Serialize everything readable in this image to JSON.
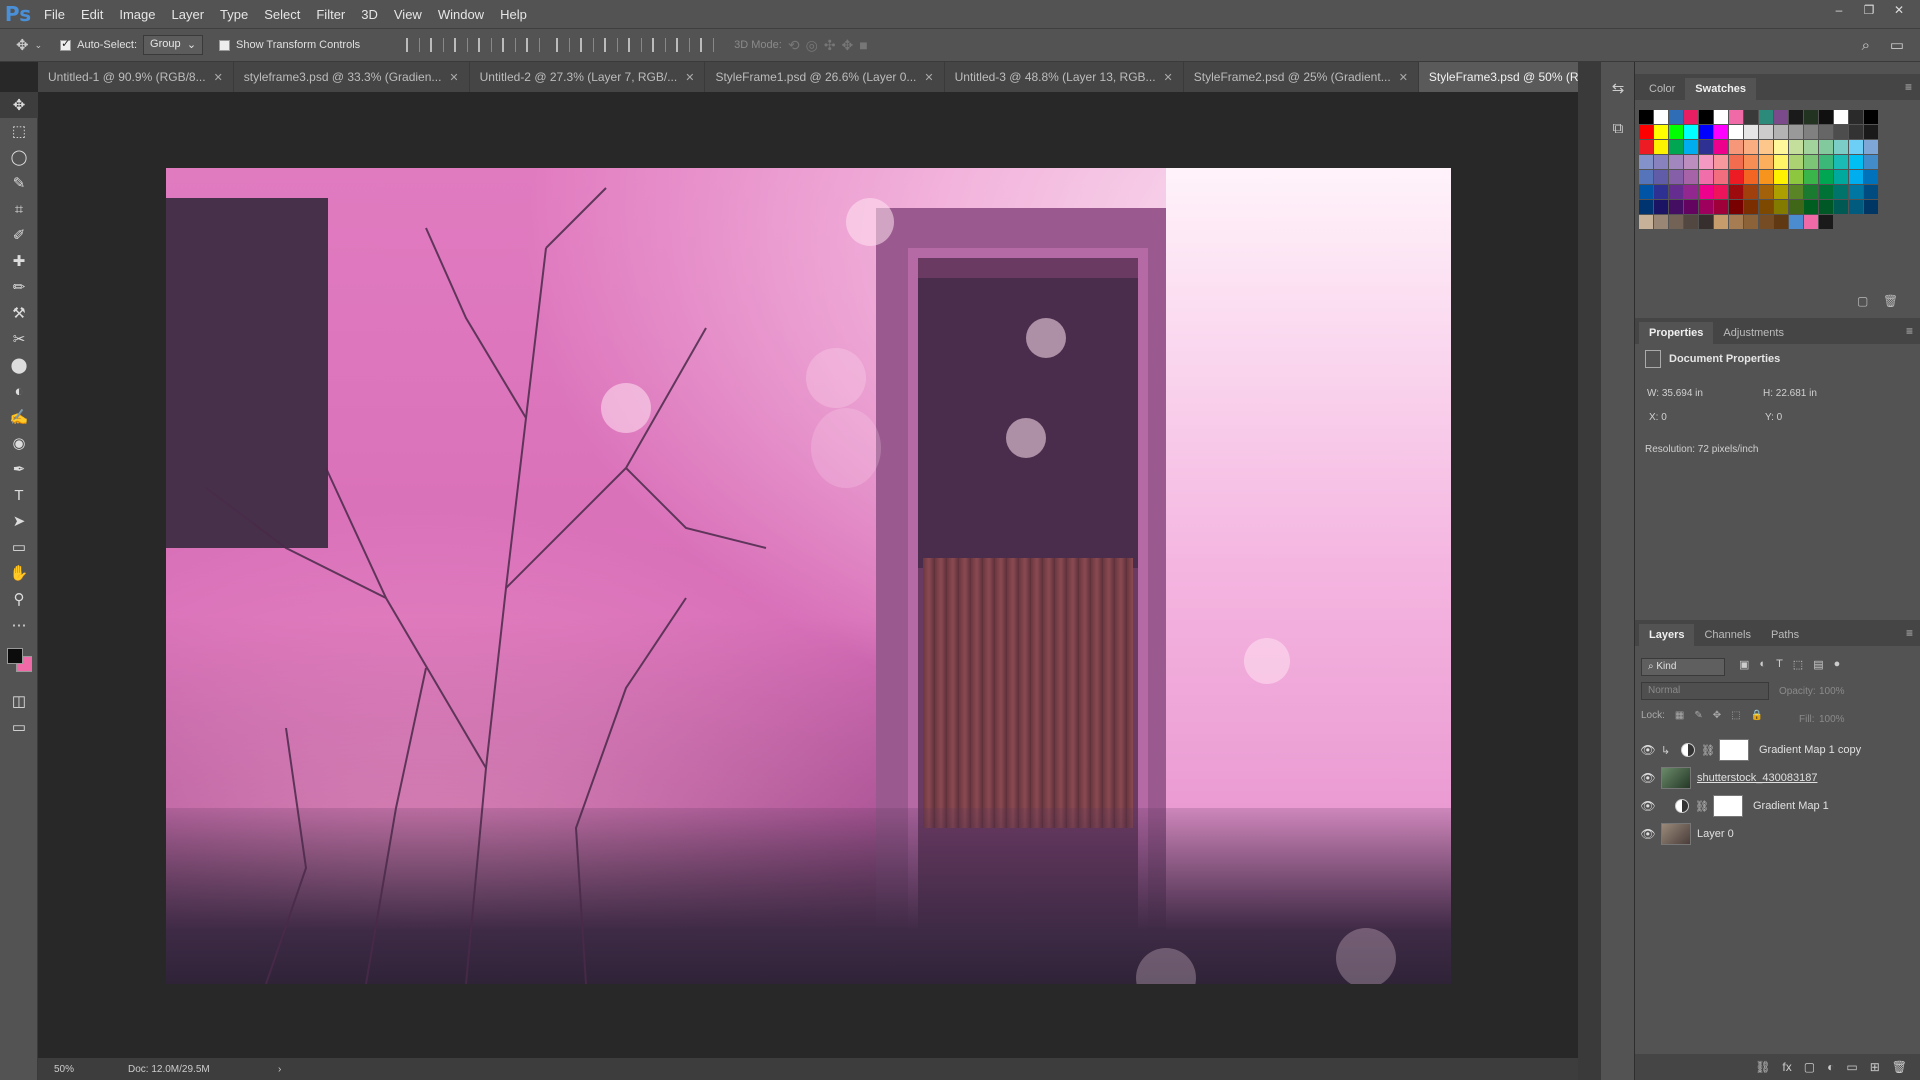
{
  "app": {
    "logo": "Ps"
  },
  "menu": [
    "File",
    "Edit",
    "Image",
    "Layer",
    "Type",
    "Select",
    "Filter",
    "3D",
    "View",
    "Window",
    "Help"
  ],
  "window_controls": [
    "–",
    "❐",
    "✕"
  ],
  "options": {
    "auto_select_label": "Auto-Select:",
    "auto_select_checked": true,
    "group_value": "Group",
    "show_transform_label": "Show Transform Controls",
    "mode_3d_label": "3D Mode:"
  },
  "tabs": [
    {
      "label": "Untitled-1 @ 90.9% (RGB/8..."
    },
    {
      "label": "styleframe3.psd @ 33.3% (Gradien..."
    },
    {
      "label": "Untitled-2 @ 27.3% (Layer 7, RGB/..."
    },
    {
      "label": "StyleFrame1.psd @ 26.6% (Layer 0..."
    },
    {
      "label": "Untitled-3 @ 48.8% (Layer 13, RGB..."
    },
    {
      "label": "StyleFrame2.psd @ 25% (Gradient..."
    },
    {
      "label": "StyleFrame3.psd @ 50% (RGB/8) *",
      "active": true
    }
  ],
  "tab_close": "✕",
  "status": {
    "zoom": "50%",
    "doc": "Doc: 12.0M/29.5M",
    "arrow": "›"
  },
  "color_panel": {
    "tabs": [
      "Color",
      "Swatches"
    ],
    "active": "Swatches"
  },
  "properties_panel": {
    "tabs": [
      "Properties",
      "Adjustments"
    ],
    "title": "Document Properties",
    "w": "W:  35.694 in",
    "h": "H:  22.681 in",
    "x": "X:  0",
    "y": "Y:  0",
    "resolution": "Resolution: 72 pixels/inch"
  },
  "layers_panel": {
    "tabs": [
      "Layers",
      "Channels",
      "Paths"
    ],
    "filter_kind": "Kind",
    "blend_mode": "Normal",
    "opacity_label": "Opacity:",
    "opacity_value": "100%",
    "fill_label": "Fill:",
    "fill_value": "100%",
    "lock_label": "Lock:",
    "layers": [
      {
        "name": "Gradient Map 1 copy"
      },
      {
        "name": "shutterstock_430083187"
      },
      {
        "name": "Gradient Map 1"
      },
      {
        "name": "Layer 0"
      }
    ]
  },
  "swatch_colors": [
    [
      "#000000",
      "#ffffff",
      "#2f6eb6",
      "#e81e63",
      "#000000",
      "#ffffff",
      "#f06aa8",
      "#3a3a3a",
      "#2c8a7a",
      "#7a4a8a",
      "#1a1a1a",
      "#223322",
      "#101010",
      "#ffffff",
      "#2a2a2a",
      "#000000"
    ],
    [
      "#ff0000",
      "#ffff00",
      "#00ff00",
      "#00ffff",
      "#0000ff",
      "#ff00ff",
      "#ffffff",
      "#e6e6e6",
      "#cccccc",
      "#b3b3b3",
      "#999999",
      "#808080",
      "#666666",
      "#4d4d4d",
      "#333333",
      "#1a1a1a"
    ],
    [
      "#ed1c24",
      "#fff200",
      "#00a651",
      "#00aeef",
      "#2e3192",
      "#ec008c",
      "#f7977a",
      "#f9ad81",
      "#fdc68a",
      "#fff79a",
      "#c4df9b",
      "#a3d39c",
      "#82ca9d",
      "#7bcdc8",
      "#6ecff6",
      "#7ea7d8"
    ],
    [
      "#8393ca",
      "#8882be",
      "#a187be",
      "#bc8dbf",
      "#f49ac2",
      "#f6989d",
      "#f26c4f",
      "#f68e55",
      "#fbaf5c",
      "#fff467",
      "#acd372",
      "#7cc576",
      "#3bb878",
      "#1abbb4",
      "#00bff3",
      "#438cca"
    ],
    [
      "#5574b9",
      "#605ca8",
      "#855fa8",
      "#a763a8",
      "#f06ea9",
      "#f26d7d",
      "#ed1c24",
      "#f26522",
      "#f7941d",
      "#fff200",
      "#8dc73f",
      "#39b54a",
      "#00a651",
      "#00a99d",
      "#00aeef",
      "#0072bc"
    ],
    [
      "#0054a6",
      "#2e3192",
      "#662d91",
      "#92278f",
      "#ec008c",
      "#ed145b",
      "#9e0b0f",
      "#a0410d",
      "#a36209",
      "#aba000",
      "#598527",
      "#1a7b30",
      "#007236",
      "#00746b",
      "#0076a3",
      "#004b80"
    ],
    [
      "#003471",
      "#1b1464",
      "#440e62",
      "#630460",
      "#9e005d",
      "#9e0039",
      "#790000",
      "#7b2e00",
      "#7d4900",
      "#827b00",
      "#406618",
      "#005e20",
      "#005826",
      "#005952",
      "#005b7f",
      "#003663"
    ],
    [
      "#c7b299",
      "#998675",
      "#736357",
      "#534741",
      "#362f2d",
      "#c69c6d",
      "#a67c52",
      "#8c6239",
      "#754c24",
      "#603913",
      "#4a8ccf",
      "#f06aa8",
      "#1a1a1a"
    ]
  ],
  "tools": [
    "✥",
    "⬚",
    "◯",
    "✎",
    "⌗",
    "✐",
    "✚",
    "✏",
    "⚒",
    "✂",
    "⬤",
    "◐",
    "✍",
    "◉",
    "✒",
    "T",
    "➤",
    "▭",
    "✋",
    "⚲",
    "⋯"
  ],
  "dock_icons": [
    "⇆",
    "⧉"
  ],
  "footer_icons": [
    "⛓",
    "fx",
    "▢",
    "◐",
    "▭",
    "⊞",
    "🗑"
  ]
}
